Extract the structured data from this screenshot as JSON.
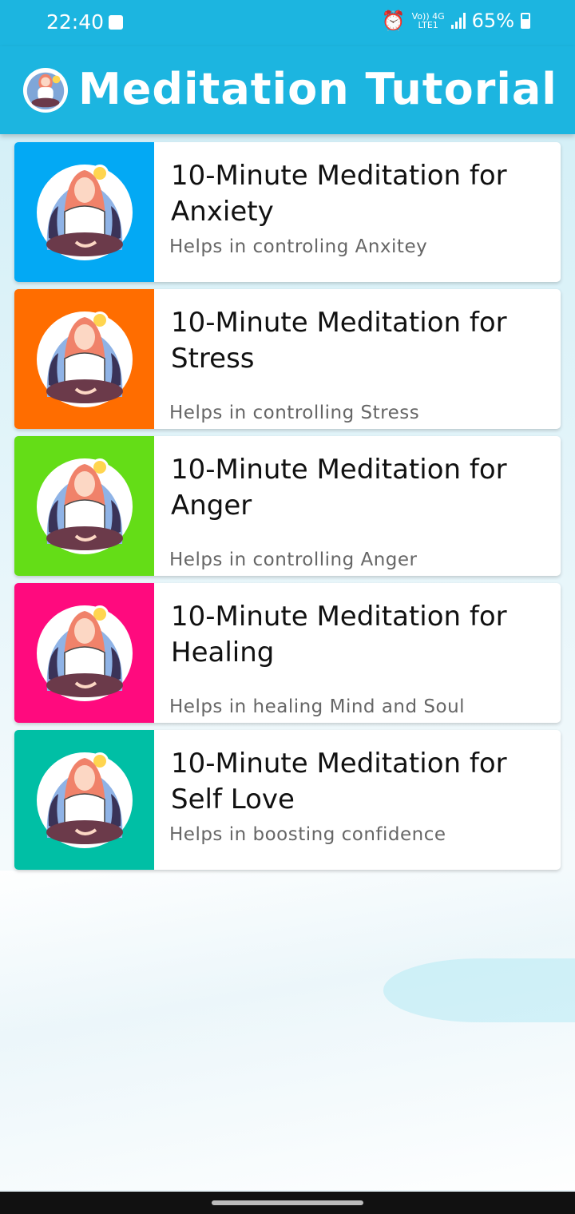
{
  "status_bar": {
    "time": "22:40",
    "network_top": "Vo)) 4G",
    "network_bottom": "LTE1",
    "battery_percent": "65%"
  },
  "app_bar": {
    "title": "Meditation Tutorial"
  },
  "items": [
    {
      "title": "10-Minute Meditation for Anxiety",
      "subtitle": "Helps in controling Anxitey",
      "color": "#03a9f4"
    },
    {
      "title": "10-Minute Meditation for Stress",
      "subtitle": "Helps in controlling Stress",
      "color": "#ff6d00"
    },
    {
      "title": "10-Minute Meditation for Anger",
      "subtitle": "Helps in controlling Anger",
      "color": "#64dd17"
    },
    {
      "title": "10-Minute Meditation for Healing",
      "subtitle": "Helps in healing Mind and Soul",
      "color": "#ff0a7e"
    },
    {
      "title": "10-Minute Meditation for Self Love",
      "subtitle": "Helps in boosting confidence",
      "color": "#00bfa5"
    }
  ]
}
